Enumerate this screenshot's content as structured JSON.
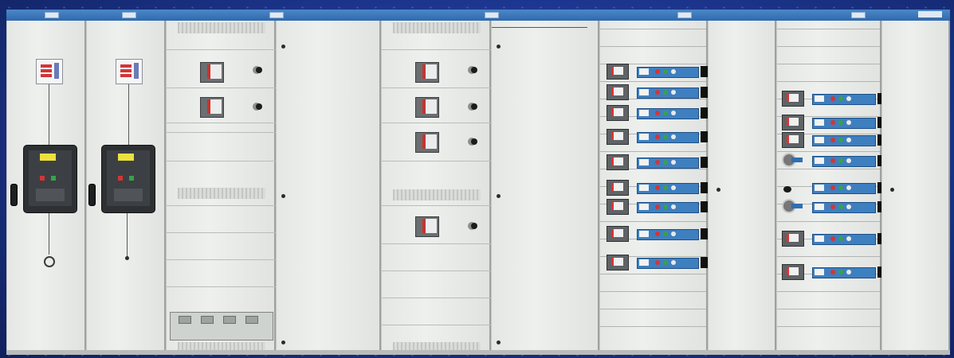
{
  "scene": {
    "background_color": "#1d3791",
    "cabinet_color": "#e8eae8",
    "top_bar_color": "#3f7abe",
    "accent_blue": "#3e7fc0",
    "breaker_yellow": "#ece13c",
    "breaker_red": "#d23636"
  }
}
